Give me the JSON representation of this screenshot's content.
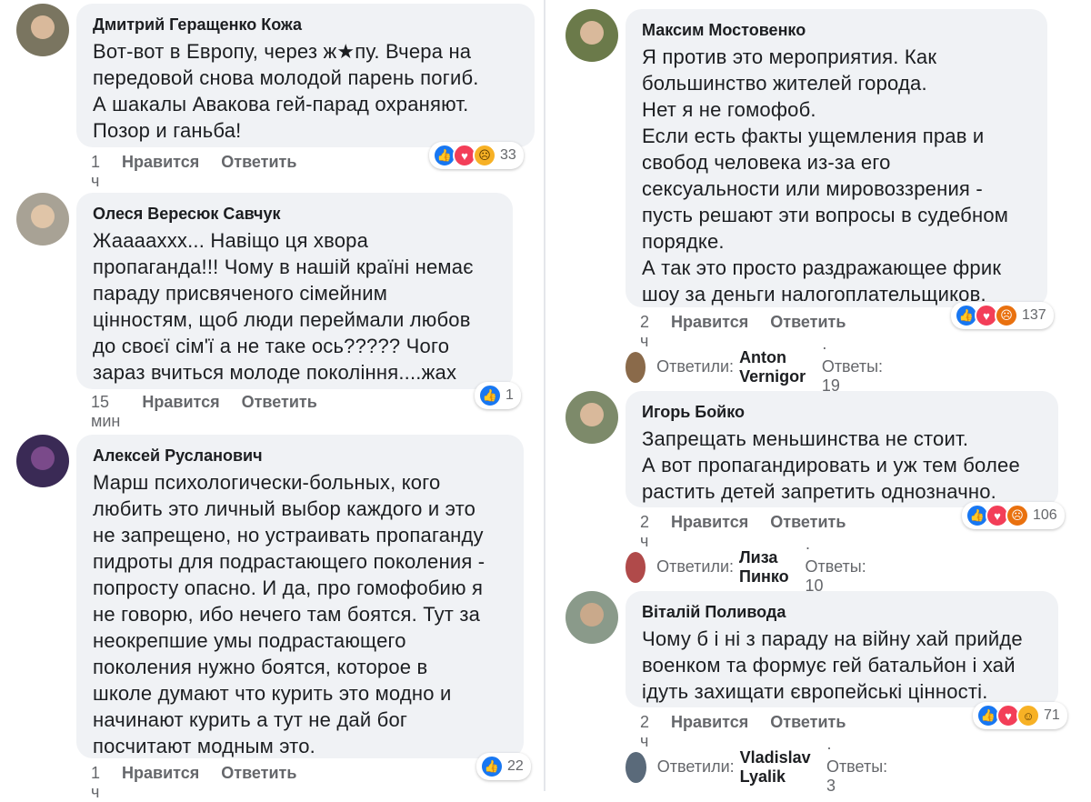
{
  "left": [
    {
      "author": "Дмитрий Геращенко Кожа",
      "text": "Вот-вот в Европу, через ж★пу. Вчера на\nпередовой снова молодой парень погиб.\nА шакалы Авакова гей-парад охраняют.\nПозор и ганьба!",
      "time": "1 ч",
      "like_label": "Нравится",
      "reply_label": "Ответить",
      "reaction_count": "33",
      "reactions": [
        "like-icon",
        "love-icon",
        "sad-icon"
      ],
      "avatar_color": "#7a7560"
    },
    {
      "author": "Олеся Вересюк Савчук",
      "text": "Жааааххх... Навіщо ця хвора\nпропаганда!!! Чому в нашій країні немає\nпараду присвяченого сімейним\nцінностям, щоб люди переймали любов\nдо своєї сім'ї а не таке ось????? Чого\nзараз вчиться молоде покоління....жах",
      "time": "15 мин",
      "like_label": "Нравится",
      "reply_label": "Ответить",
      "reaction_count": "1",
      "reactions": [
        "like-icon"
      ],
      "avatar_color": "#a8a295"
    },
    {
      "author": "Алексей Русланович",
      "text": "Марш психологически-больных, кого\nлюбить это личный выбор каждого и это\nне запрещено, но устраивать пропаганду\nпидроты для подрастающего поколения -\nпопросту опасно. И да, про гомофобию я\nне говорю, ибо нечего там боятся. Тут за\nнеокрепшие умы подрастающего\nпоколения нужно боятся, которое в\nшколе думают что курить это модно и\nначинают курить а тут не дай бог\nпосчитают модным это.",
      "time": "1 ч",
      "like_label": "Нравится",
      "reply_label": "Ответить",
      "reaction_count": "22",
      "reactions": [
        "like-icon"
      ],
      "avatar_color": "#3a2a55"
    }
  ],
  "right": [
    {
      "author": "Максим Мостовенко",
      "text": "Я против это мероприятия. Как\nбольшинство жителей города.\nНет я не гомофоб.\nЕсли есть факты ущемления прав и\nсвобод  человека из-за его\nсексуальности или мировоззрения -\nпусть решают эти вопросы в судебном\nпорядке.\nА так это просто раздражающее фрик\nшоу за деньги налогоплательщиков.",
      "time": "2 ч",
      "like_label": "Нравится",
      "reply_label": "Ответить",
      "reaction_count": "137",
      "reactions": [
        "like-icon",
        "love-icon",
        "angry-icon"
      ],
      "avatar_color": "#6b7a4a",
      "replies_label": "Ответили:",
      "replies_who": "Anton Vernigor",
      "replies_count": "· Ответы: 19",
      "reply_avatar_color": "#8a6a4a"
    },
    {
      "author": "Игорь Бойко",
      "text": "Запрещать меньшинства не стоит.\nА вот пропагандировать и уж тем более\nрастить детей запретить однозначно.",
      "time": "2 ч",
      "like_label": "Нравится",
      "reply_label": "Ответить",
      "reaction_count": "106",
      "reactions": [
        "like-icon",
        "love-icon",
        "angry-icon"
      ],
      "avatar_color": "#7d8a6a",
      "replies_label": "Ответили:",
      "replies_who": "Лиза Пинко",
      "replies_count": "· Ответы: 10",
      "reply_avatar_color": "#b04a4a"
    },
    {
      "author": "Віталій Поливода",
      "text": "Чому б і ні з параду на війну хай прийде\nвоенком та формує гей батальйон і хай\nідуть захищати європейські цінності.",
      "time": "2 ч",
      "like_label": "Нравится",
      "reply_label": "Ответить",
      "reaction_count": "71",
      "reactions": [
        "like-icon",
        "love-icon",
        "haha-icon"
      ],
      "avatar_color": "#8a9a8a",
      "replies_label": "Ответили:",
      "replies_who": "Vladislav Lyalik",
      "replies_count": "· Ответы: 3",
      "reply_avatar_color": "#5a6a7a"
    }
  ]
}
